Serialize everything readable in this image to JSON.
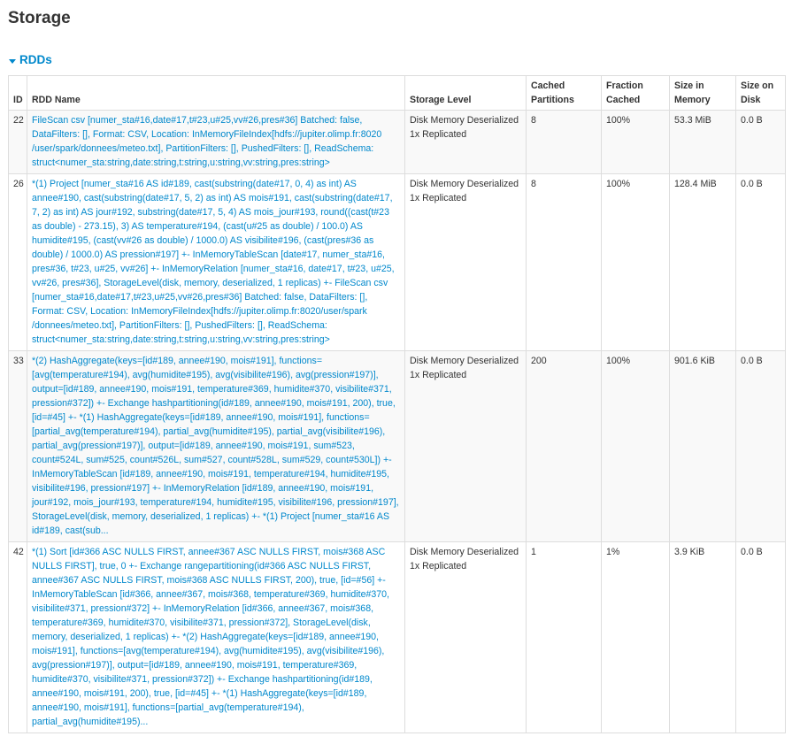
{
  "page": {
    "title": "Storage"
  },
  "section": {
    "label": "RDDs",
    "icon": "caret-down-icon"
  },
  "table": {
    "headers": {
      "id": "ID",
      "name": "RDD Name",
      "level": "Storage Level",
      "cached_line1": "Cached",
      "cached_line2": "Partitions",
      "fraction_line1": "Fraction",
      "fraction_line2": "Cached",
      "mem_line1": "Size in",
      "mem_line2": "Memory",
      "disk_line1": "Size on",
      "disk_line2": "Disk"
    },
    "rows": [
      {
        "id": "22",
        "name": "FileScan csv [numer_sta#16,date#17,t#23,u#25,vv#26,pres#36] Batched: false, DataFilters: [], Format: CSV, Location: InMemoryFileIndex[hdfs://jupiter.olimp.fr:8020 /user/spark/donnees/meteo.txt], PartitionFilters: [], PushedFilters: [], ReadSchema: struct<numer_sta:string,date:string,t:string,u:string,vv:string,pres:string>",
        "level_line1": "Disk Memory Deserialized",
        "level_line2": "1x Replicated",
        "cached_partitions": "8",
        "fraction_cached": "100%",
        "size_memory": "53.3 MiB",
        "size_disk": "0.0 B"
      },
      {
        "id": "26",
        "name": "*(1) Project [numer_sta#16 AS id#189, cast(substring(date#17, 0, 4) as int) AS annee#190, cast(substring(date#17, 5, 2) as int) AS mois#191, cast(substring(date#17, 7, 2) as int) AS jour#192, substring(date#17, 5, 4) AS mois_jour#193, round((cast(t#23 as double) - 273.15), 3) AS temperature#194, (cast(u#25 as double) / 100.0) AS humidite#195, (cast(vv#26 as double) / 1000.0) AS visibilite#196, (cast(pres#36 as double) / 1000.0) AS pression#197] +- InMemoryTableScan [date#17, numer_sta#16, pres#36, t#23, u#25, vv#26] +- InMemoryRelation [numer_sta#16, date#17, t#23, u#25, vv#26, pres#36], StorageLevel(disk, memory, deserialized, 1 replicas) +- FileScan csv [numer_sta#16,date#17,t#23,u#25,vv#26,pres#36] Batched: false, DataFilters: [], Format: CSV, Location: InMemoryFileIndex[hdfs://jupiter.olimp.fr:8020/user/spark /donnees/meteo.txt], PartitionFilters: [], PushedFilters: [], ReadSchema: struct<numer_sta:string,date:string,t:string,u:string,vv:string,pres:string>",
        "level_line1": "Disk Memory Deserialized",
        "level_line2": "1x Replicated",
        "cached_partitions": "8",
        "fraction_cached": "100%",
        "size_memory": "128.4 MiB",
        "size_disk": "0.0 B"
      },
      {
        "id": "33",
        "name": "*(2) HashAggregate(keys=[id#189, annee#190, mois#191], functions=[avg(temperature#194), avg(humidite#195), avg(visibilite#196), avg(pression#197)], output=[id#189, annee#190, mois#191, temperature#369, humidite#370, visibilite#371, pression#372]) +- Exchange hashpartitioning(id#189, annee#190, mois#191, 200), true, [id=#45] +- *(1) HashAggregate(keys=[id#189, annee#190, mois#191], functions=[partial_avg(temperature#194), partial_avg(humidite#195), partial_avg(visibilite#196), partial_avg(pression#197)], output=[id#189, annee#190, mois#191, sum#523, count#524L, sum#525, count#526L, sum#527, count#528L, sum#529, count#530L]) +- InMemoryTableScan [id#189, annee#190, mois#191, temperature#194, humidite#195, visibilite#196, pression#197] +- InMemoryRelation [id#189, annee#190, mois#191, jour#192, mois_jour#193, temperature#194, humidite#195, visibilite#196, pression#197], StorageLevel(disk, memory, deserialized, 1 replicas) +- *(1) Project [numer_sta#16 AS id#189, cast(sub...",
        "level_line1": "Disk Memory Deserialized",
        "level_line2": "1x Replicated",
        "cached_partitions": "200",
        "fraction_cached": "100%",
        "size_memory": "901.6 KiB",
        "size_disk": "0.0 B"
      },
      {
        "id": "42",
        "name": "*(1) Sort [id#366 ASC NULLS FIRST, annee#367 ASC NULLS FIRST, mois#368 ASC NULLS FIRST], true, 0 +- Exchange rangepartitioning(id#366 ASC NULLS FIRST, annee#367 ASC NULLS FIRST, mois#368 ASC NULLS FIRST, 200), true, [id=#56] +- InMemoryTableScan [id#366, annee#367, mois#368, temperature#369, humidite#370, visibilite#371, pression#372] +- InMemoryRelation [id#366, annee#367, mois#368, temperature#369, humidite#370, visibilite#371, pression#372], StorageLevel(disk, memory, deserialized, 1 replicas) +- *(2) HashAggregate(keys=[id#189, annee#190, mois#191], functions=[avg(temperature#194), avg(humidite#195), avg(visibilite#196), avg(pression#197)], output=[id#189, annee#190, mois#191, temperature#369, humidite#370, visibilite#371, pression#372]) +- Exchange hashpartitioning(id#189, annee#190, mois#191, 200), true, [id=#45] +- *(1) HashAggregate(keys=[id#189, annee#190, mois#191], functions=[partial_avg(temperature#194), partial_avg(humidite#195)...",
        "level_line1": "Disk Memory Deserialized",
        "level_line2": "1x Replicated",
        "cached_partitions": "1",
        "fraction_cached": "1%",
        "size_memory": "3.9 KiB",
        "size_disk": "0.0 B"
      }
    ]
  },
  "colors": {
    "link": "#0088cc",
    "text": "#333333",
    "border": "#dddddd",
    "stripe": "#f9f9f9"
  }
}
